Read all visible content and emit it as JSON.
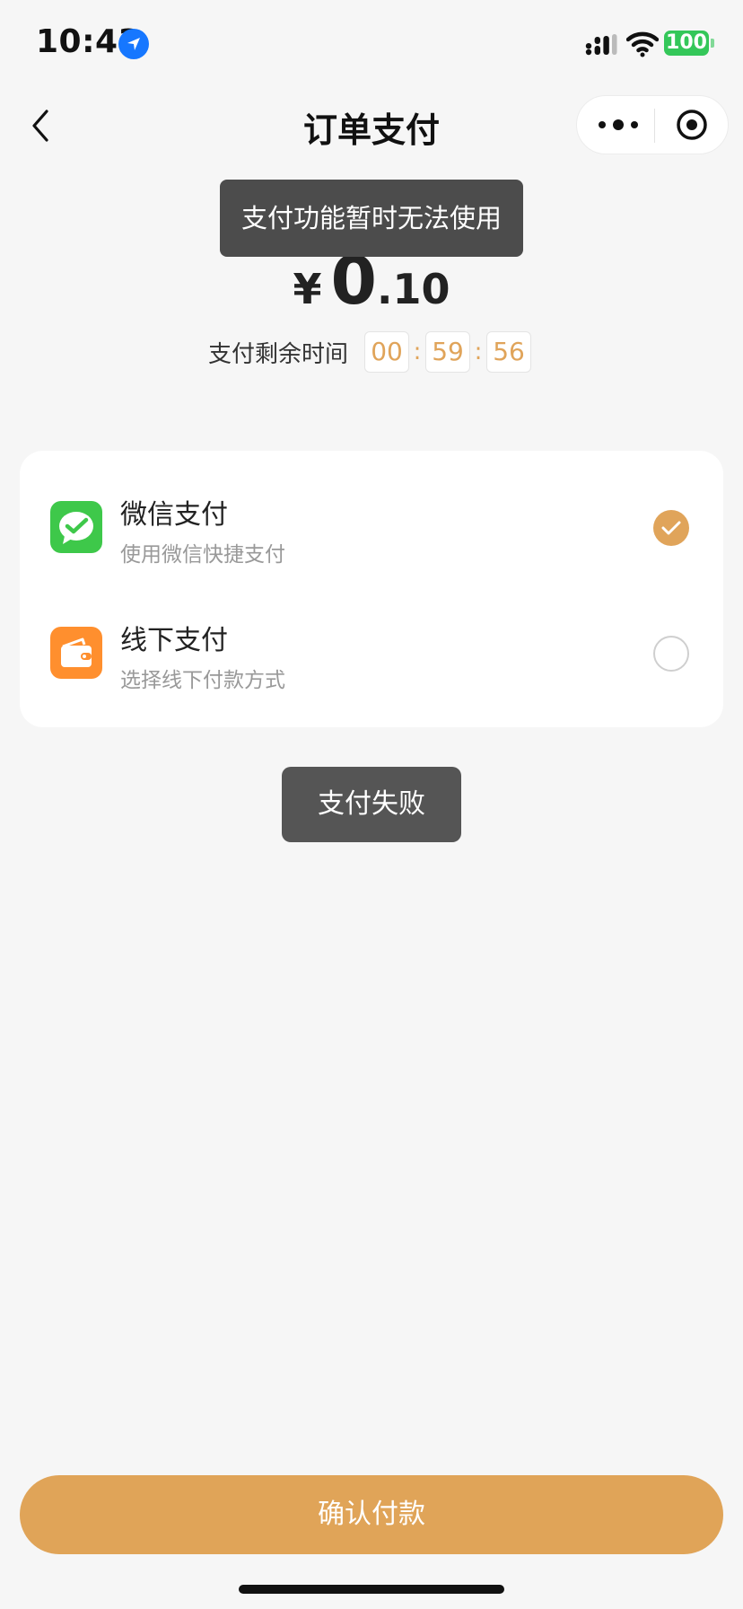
{
  "status_bar": {
    "time": "10:43",
    "battery": "100"
  },
  "nav": {
    "title": "订单支付"
  },
  "toasts": {
    "top": "支付功能暂时无法使用",
    "fail": "支付失败"
  },
  "amount": {
    "currency": "¥",
    "integer": "0",
    "decimal": ".10"
  },
  "countdown": {
    "label": "支付剩余时间",
    "hours": "00",
    "minutes": "59",
    "seconds": "56",
    "separator": ":"
  },
  "payment_methods": [
    {
      "name": "微信支付",
      "desc": "使用微信快捷支付",
      "selected": true,
      "icon": "wechat-pay-icon",
      "color": "#3ec84a"
    },
    {
      "name": "线下支付",
      "desc": "选择线下付款方式",
      "selected": false,
      "icon": "wallet-icon",
      "color": "#ff8f2e"
    }
  ],
  "confirm": {
    "label": "确认付款"
  },
  "colors": {
    "accent": "#e0a45a",
    "background": "#f6f6f6",
    "toast": "#4c4c4c"
  }
}
